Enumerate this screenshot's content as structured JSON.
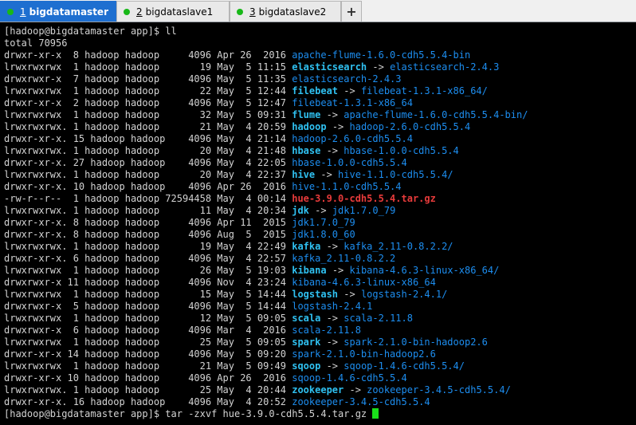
{
  "tabs": [
    {
      "num": "1",
      "label": " bigdatamaster",
      "active": true
    },
    {
      "num": "2",
      "label": " bigdataslave1",
      "active": false
    },
    {
      "num": "3",
      "label": " bigdataslave2",
      "active": false
    }
  ],
  "new_tab_label": "+",
  "prompt": "[hadoop@bigdatamaster app]$ ",
  "command1": "ll",
  "total": "total 70956",
  "entries": [
    {
      "meta": "drwxr-xr-x  8 hadoop hadoop     4096 Apr 26  2016 ",
      "name": "apache-flume-1.6.0-cdh5.5.4-bin",
      "kind": "dir",
      "target": ""
    },
    {
      "meta": "lrwxrwxrwx  1 hadoop hadoop       19 May  5 11:15 ",
      "name": "elasticsearch",
      "kind": "link",
      "target": "elasticsearch-2.4.3"
    },
    {
      "meta": "drwxrwxr-x  7 hadoop hadoop     4096 May  5 11:35 ",
      "name": "elasticsearch-2.4.3",
      "kind": "dir",
      "target": ""
    },
    {
      "meta": "lrwxrwxrwx  1 hadoop hadoop       22 May  5 12:44 ",
      "name": "filebeat",
      "kind": "link",
      "target": "filebeat-1.3.1-x86_64/"
    },
    {
      "meta": "drwxr-xr-x  2 hadoop hadoop     4096 May  5 12:47 ",
      "name": "filebeat-1.3.1-x86_64",
      "kind": "dir",
      "target": ""
    },
    {
      "meta": "lrwxrwxrwx  1 hadoop hadoop       32 May  5 09:31 ",
      "name": "flume",
      "kind": "link",
      "target": "apache-flume-1.6.0-cdh5.5.4-bin/"
    },
    {
      "meta": "lrwxrwxrwx. 1 hadoop hadoop       21 May  4 20:59 ",
      "name": "hadoop",
      "kind": "link",
      "target": "hadoop-2.6.0-cdh5.5.4"
    },
    {
      "meta": "drwxr-xr-x. 15 hadoop hadoop    4096 May  4 21:14 ",
      "name": "hadoop-2.6.0-cdh5.5.4",
      "kind": "dir",
      "target": ""
    },
    {
      "meta": "lrwxrwxrwx. 1 hadoop hadoop       20 May  4 21:48 ",
      "name": "hbase",
      "kind": "link",
      "target": "hbase-1.0.0-cdh5.5.4"
    },
    {
      "meta": "drwxr-xr-x. 27 hadoop hadoop    4096 May  4 22:05 ",
      "name": "hbase-1.0.0-cdh5.5.4",
      "kind": "dir",
      "target": ""
    },
    {
      "meta": "lrwxrwxrwx. 1 hadoop hadoop       20 May  4 22:37 ",
      "name": "hive",
      "kind": "link",
      "target": "hive-1.1.0-cdh5.5.4/"
    },
    {
      "meta": "drwxr-xr-x. 10 hadoop hadoop    4096 Apr 26  2016 ",
      "name": "hive-1.1.0-cdh5.5.4",
      "kind": "dir",
      "target": ""
    },
    {
      "meta": "-rw-r--r--  1 hadoop hadoop 72594458 May  4 00:14 ",
      "name": "hue-3.9.0-cdh5.5.4.tar.gz",
      "kind": "archive",
      "target": ""
    },
    {
      "meta": "lrwxrwxrwx. 1 hadoop hadoop       11 May  4 20:34 ",
      "name": "jdk",
      "kind": "link",
      "target": "jdk1.7.0_79"
    },
    {
      "meta": "drwxr-xr-x. 8 hadoop hadoop     4096 Apr 11  2015 ",
      "name": "jdk1.7.0_79",
      "kind": "dir",
      "target": ""
    },
    {
      "meta": "drwxr-xr-x. 8 hadoop hadoop     4096 Aug  5  2015 ",
      "name": "jdk1.8.0_60",
      "kind": "dir",
      "target": ""
    },
    {
      "meta": "lrwxrwxrwx. 1 hadoop hadoop       19 May  4 22:49 ",
      "name": "kafka",
      "kind": "link",
      "target": "kafka_2.11-0.8.2.2/"
    },
    {
      "meta": "drwxr-xr-x. 6 hadoop hadoop     4096 May  4 22:57 ",
      "name": "kafka_2.11-0.8.2.2",
      "kind": "dir",
      "target": ""
    },
    {
      "meta": "lrwxrwxrwx  1 hadoop hadoop       26 May  5 19:03 ",
      "name": "kibana",
      "kind": "link",
      "target": "kibana-4.6.3-linux-x86_64/"
    },
    {
      "meta": "drwxrwxr-x 11 hadoop hadoop     4096 Nov  4 23:24 ",
      "name": "kibana-4.6.3-linux-x86_64",
      "kind": "dir",
      "target": ""
    },
    {
      "meta": "lrwxrwxrwx  1 hadoop hadoop       15 May  5 14:44 ",
      "name": "logstash",
      "kind": "link",
      "target": "logstash-2.4.1/"
    },
    {
      "meta": "drwxrwxr-x  5 hadoop hadoop     4096 May  5 14:44 ",
      "name": "logstash-2.4.1",
      "kind": "dir",
      "target": ""
    },
    {
      "meta": "lrwxrwxrwx  1 hadoop hadoop       12 May  5 09:05 ",
      "name": "scala",
      "kind": "link",
      "target": "scala-2.11.8"
    },
    {
      "meta": "drwxrwxr-x  6 hadoop hadoop     4096 Mar  4  2016 ",
      "name": "scala-2.11.8",
      "kind": "dir",
      "target": ""
    },
    {
      "meta": "lrwxrwxrwx  1 hadoop hadoop       25 May  5 09:05 ",
      "name": "spark",
      "kind": "link",
      "target": "spark-2.1.0-bin-hadoop2.6"
    },
    {
      "meta": "drwxr-xr-x 14 hadoop hadoop     4096 May  5 09:20 ",
      "name": "spark-2.1.0-bin-hadoop2.6",
      "kind": "dir",
      "target": ""
    },
    {
      "meta": "lrwxrwxrwx  1 hadoop hadoop       21 May  5 09:49 ",
      "name": "sqoop",
      "kind": "link",
      "target": "sqoop-1.4.6-cdh5.5.4/"
    },
    {
      "meta": "drwxr-xr-x 10 hadoop hadoop     4096 Apr 26  2016 ",
      "name": "sqoop-1.4.6-cdh5.5.4",
      "kind": "dir",
      "target": ""
    },
    {
      "meta": "lrwxrwxrwx. 1 hadoop hadoop       25 May  4 20:44 ",
      "name": "zookeeper",
      "kind": "link",
      "target": "zookeeper-3.4.5-cdh5.5.4/"
    },
    {
      "meta": "drwxr-xr-x. 16 hadoop hadoop    4096 May  4 20:52 ",
      "name": "zookeeper-3.4.5-cdh5.5.4",
      "kind": "dir",
      "target": ""
    }
  ],
  "arrow": " -> ",
  "command2": "tar -zxvf hue-3.9.0-cdh5.5.4.tar.gz ",
  "colors": {
    "dir": "#1d8ef0",
    "link": "#2fc0f0",
    "archive": "#e83b3b",
    "cursor": "#1adf1a",
    "active_tab": "#1e6fd0"
  },
  "icons": {
    "tab_status": "green-dot-icon"
  }
}
